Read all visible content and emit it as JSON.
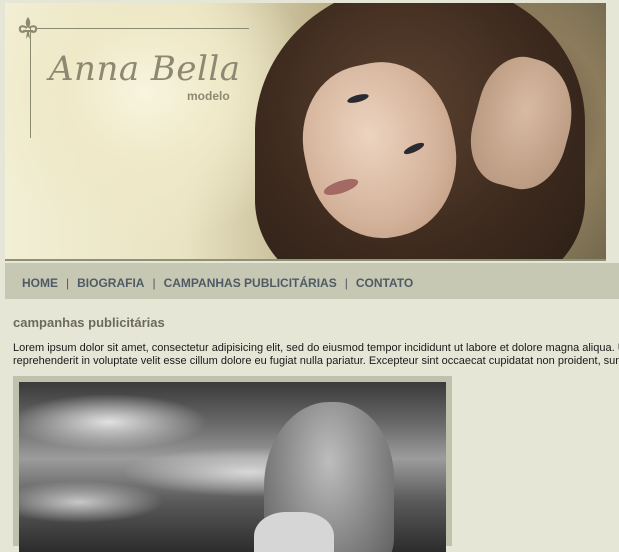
{
  "header": {
    "title": "Anna Bella",
    "subtitle": "modelo",
    "logo_icon": "fleur-de-lis-icon"
  },
  "nav": {
    "items": [
      {
        "label": "HOME"
      },
      {
        "label": "BIOGRAFIA"
      },
      {
        "label": "CAMPANHAS PUBLICITÁRIAS"
      },
      {
        "label": "CONTATO"
      }
    ],
    "separator": "|"
  },
  "main": {
    "section_title": "campanhas publicitárias",
    "paragraph_line1": "Lorem ipsum dolor sit amet, consectetur adipisicing elit, sed do eiusmod tempor incididunt ut labore et dolore magna aliqua. Ut e",
    "paragraph_line2": "reprehenderit in voluptate velit esse cillum dolore eu fugiat nulla pariatur. Excepteur sint occaecat cupidatat non proident, sunt in"
  },
  "colors": {
    "background": "#e6e6d6",
    "nav_background": "#c7c8b4",
    "nav_text": "#4f5b64",
    "title_text": "#8e8873",
    "section_title": "#6c6a5c"
  }
}
